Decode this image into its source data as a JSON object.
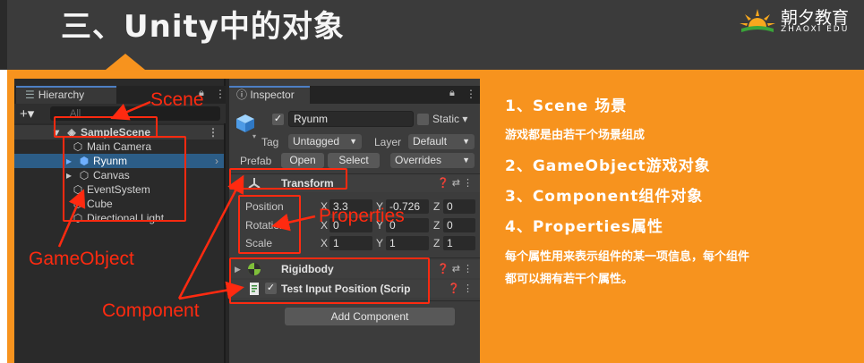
{
  "slide": {
    "title": "三、Unity中的对象",
    "logo_cn": "朝夕教育",
    "logo_en": "ZHAOXI EDU"
  },
  "hierarchy": {
    "tab_label": "Hierarchy",
    "search_placeholder": "All",
    "scene_name": "SampleScene",
    "objects": [
      "Main Camera",
      "Ryunm",
      "Canvas",
      "EventSystem",
      "Cube",
      "Directional Light"
    ]
  },
  "inspector": {
    "tab_label": "Inspector",
    "object_name": "Ryunm",
    "static_label": "Static",
    "tag_label": "Tag",
    "tag_value": "Untagged",
    "layer_label": "Layer",
    "layer_value": "Default",
    "prefab_label": "Prefab",
    "open_label": "Open",
    "select_label": "Select",
    "overrides_label": "Overrides",
    "transform": {
      "name": "Transform",
      "position_label": "Position",
      "rotation_label": "Rotation",
      "scale_label": "Scale",
      "position": {
        "x": "3.3",
        "y": "-0.726",
        "z": "0"
      },
      "rotation": {
        "x": "0",
        "y": "0",
        "z": "0"
      },
      "scale": {
        "x": "1",
        "y": "1",
        "z": "1"
      }
    },
    "rigidbody_name": "Rigidbody",
    "script_name": "Test Input Position (Scrip",
    "add_component_label": "Add Component"
  },
  "annotations": {
    "scene": "Scene",
    "gameobject": "GameObject",
    "properties": "Properties",
    "component": "Component",
    "color": "#ff2a10"
  },
  "explanation": {
    "item1": "1、Scene 场景",
    "item1_desc": "游戏都是由若干个场景组成",
    "item2": "2、GameObject游戏对象",
    "item3": "3、Component组件对象",
    "item4": "4、Properties属性",
    "item4_desc_line1": "每个属性用来表示组件的某一项信息，每个组件",
    "item4_desc_line2": "都可以拥有若干个属性。"
  },
  "colors": {
    "header_bg": "#3b3b3b",
    "accent_orange": "#f7931e",
    "selection_blue": "#2c5d87"
  }
}
